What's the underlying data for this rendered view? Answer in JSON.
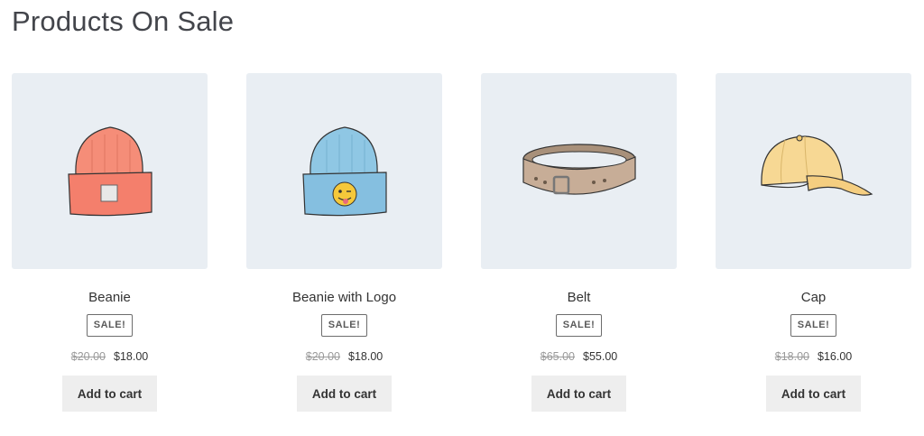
{
  "section": {
    "title": "Products On Sale"
  },
  "products": [
    {
      "name": "Beanie",
      "badge": "SALE!",
      "regular_price": "$20.00",
      "sale_price": "$18.00",
      "button": "Add to cart",
      "image_icon": "beanie-icon",
      "color": "#f58d78"
    },
    {
      "name": "Beanie with Logo",
      "badge": "SALE!",
      "regular_price": "$20.00",
      "sale_price": "$18.00",
      "button": "Add to cart",
      "image_icon": "beanie-logo-icon",
      "color": "#8fc7e4"
    },
    {
      "name": "Belt",
      "badge": "SALE!",
      "regular_price": "$65.00",
      "sale_price": "$55.00",
      "button": "Add to cart",
      "image_icon": "belt-icon",
      "color": "#c7ad97"
    },
    {
      "name": "Cap",
      "badge": "SALE!",
      "regular_price": "$18.00",
      "sale_price": "$16.00",
      "button": "Add to cart",
      "image_icon": "cap-icon",
      "color": "#f7d894"
    }
  ]
}
